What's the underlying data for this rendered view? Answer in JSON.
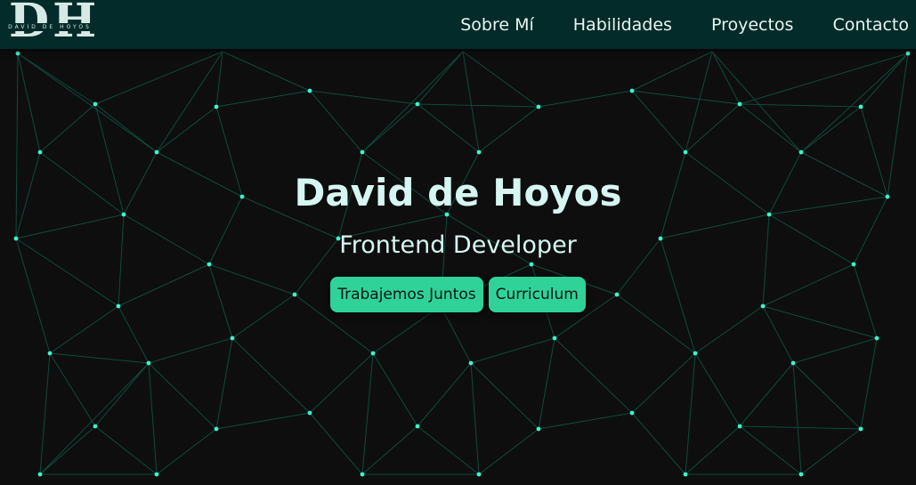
{
  "header": {
    "logo_monogram": "DH",
    "logo_subtitle": "DAVID DE HOYOS",
    "nav": [
      {
        "label": "Sobre Mí"
      },
      {
        "label": "Habilidades"
      },
      {
        "label": "Proyectos"
      },
      {
        "label": "Contacto"
      }
    ]
  },
  "hero": {
    "name": "David de Hoyos",
    "role": "Frontend Developer",
    "buttons": [
      {
        "label": "Trabajemos Juntos"
      },
      {
        "label": "Curriculum"
      }
    ]
  },
  "colors": {
    "header_bg": "#032b29",
    "page_bg": "#0e0e0e",
    "accent": "#2fd39a",
    "node": "#3df5c8",
    "link": "#0f4a3c",
    "title_text": "#d6f6f2"
  }
}
